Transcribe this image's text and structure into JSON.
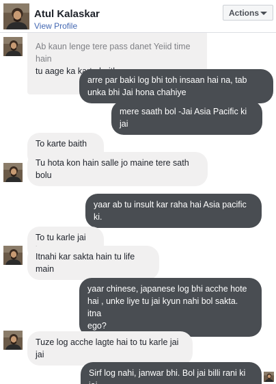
{
  "header": {
    "name": "Atul Kalaskar",
    "profile_link": "View Profile",
    "actions_label": "Actions"
  },
  "messages": [
    {
      "side": "in",
      "text": "Ab kaun lenge tere pass danet Yeiid time hain"
    },
    {
      "side": "in",
      "text": "tu aage ka karte baith"
    },
    {
      "side": "out",
      "text": "arre par baki log bhi toh insaan hai na, tab\nunka bhi Jai hona chahiye"
    },
    {
      "side": "out",
      "text": "mere saath bol -Jai Asia Pacific ki jai"
    },
    {
      "side": "in",
      "text": "To karte baith tu"
    },
    {
      "side": "in",
      "text": "Tu hota kon hain salle jo maine tere sath\nbolu"
    },
    {
      "side": "out",
      "text": "yaar ab tu insult kar raha hai Asia pacific ki."
    },
    {
      "side": "in",
      "text": "To tu karle jai jai"
    },
    {
      "side": "in",
      "text": "Itnahi kar sakta hain tu life main"
    },
    {
      "side": "out",
      "text": "yaar chinese, japanese log bhi acche hote\nhai , unke liye tu jai kyun nahi bol sakta. itna\nego?"
    },
    {
      "side": "in",
      "text": "Tuze log acche lagte hai to tu karle jai jai"
    },
    {
      "side": "out",
      "text": "Sirf log nahi, janwar bhi. Bol jai billi rani ki jai."
    }
  ]
}
